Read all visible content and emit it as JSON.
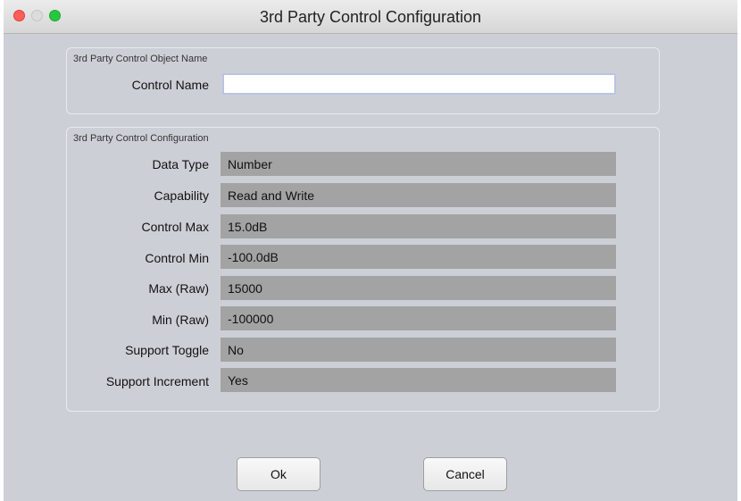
{
  "window": {
    "title": "3rd Party Control Configuration",
    "traffic_lights": [
      "close-icon",
      "minimize-icon",
      "zoom-icon"
    ]
  },
  "object_name_group": {
    "title": "3rd Party Control Object Name",
    "control_name_label": "Control Name",
    "control_name_value": ""
  },
  "config_group": {
    "title": "3rd Party Control Configuration",
    "rows": [
      {
        "label": "Data Type",
        "value": "Number"
      },
      {
        "label": "Capability",
        "value": "Read and Write"
      },
      {
        "label": "Control Max",
        "value": "15.0dB"
      },
      {
        "label": "Control Min",
        "value": "-100.0dB"
      },
      {
        "label": "Max (Raw)",
        "value": "15000"
      },
      {
        "label": "Min (Raw)",
        "value": "-100000"
      },
      {
        "label": "Support Toggle",
        "value": "No"
      },
      {
        "label": "Support Increment",
        "value": "Yes"
      }
    ]
  },
  "buttons": {
    "ok_label": "Ok",
    "cancel_label": "Cancel"
  }
}
